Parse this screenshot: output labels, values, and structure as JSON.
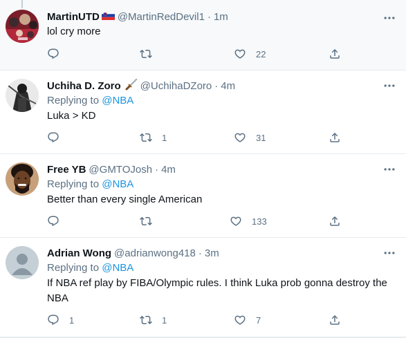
{
  "tweets": [
    {
      "display_name": "MartinUTD",
      "handle": "@MartinRedDevil1",
      "separator": "·",
      "time": "1m",
      "text": "lol cry more",
      "replies": "",
      "retweets": "",
      "likes": "22",
      "flag_icon": "slovenia-flag-icon"
    },
    {
      "display_name": "Uchiha D. Zoro",
      "handle": "@UchihaDZoro",
      "separator": "·",
      "time": "4m",
      "replying_prefix": "Replying to",
      "replying_to": "@NBA",
      "text": "Luka > KD",
      "replies": "",
      "retweets": "1",
      "likes": "31",
      "emoji_icon": "dagger-icon"
    },
    {
      "display_name": "Free YB",
      "handle": "@GMTOJosh",
      "separator": "·",
      "time": "4m",
      "replying_prefix": "Replying to",
      "replying_to": "@NBA",
      "text": "Better than every single American",
      "replies": "",
      "retweets": "",
      "likes": "133"
    },
    {
      "display_name": "Adrian Wong",
      "handle": "@adrianwong418",
      "separator": "·",
      "time": "3m",
      "replying_prefix": "Replying to",
      "replying_to": "@NBA",
      "text_line1": "If NBA ref play by FIBA/Olympic rules. I think Luka prob gonna destroy the",
      "text_line2": "NBA",
      "replies": "1",
      "retweets": "1",
      "likes": "7"
    }
  ],
  "colors": {
    "text_primary": "#0f1419",
    "text_secondary": "#5b7083",
    "link": "#1b95e0",
    "divider": "#e6ecf0",
    "highlight_bg": "#f7f9fa"
  }
}
